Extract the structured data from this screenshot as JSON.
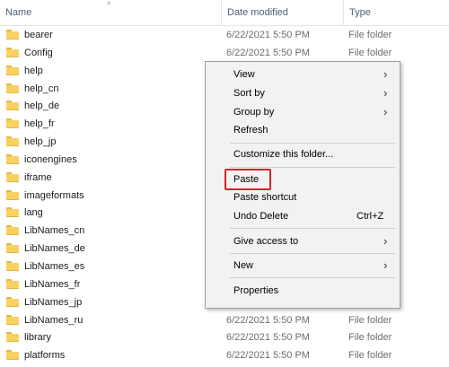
{
  "columns": {
    "name": "Name",
    "date": "Date modified",
    "type": "Type"
  },
  "sort_indicator": "^",
  "files": [
    {
      "name": "bearer",
      "date": "6/22/2021 5:50 PM",
      "type": "File folder"
    },
    {
      "name": "Config",
      "date": "6/22/2021 5:50 PM",
      "type": "File folder"
    },
    {
      "name": "help",
      "date": "",
      "type": ""
    },
    {
      "name": "help_cn",
      "date": "",
      "type": ""
    },
    {
      "name": "help_de",
      "date": "",
      "type": ""
    },
    {
      "name": "help_fr",
      "date": "",
      "type": ""
    },
    {
      "name": "help_jp",
      "date": "",
      "type": ""
    },
    {
      "name": "iconengines",
      "date": "",
      "type": ""
    },
    {
      "name": "iframe",
      "date": "",
      "type": ""
    },
    {
      "name": "imageformats",
      "date": "",
      "type": ""
    },
    {
      "name": "lang",
      "date": "",
      "type": ""
    },
    {
      "name": "LibNames_cn",
      "date": "",
      "type": ""
    },
    {
      "name": "LibNames_de",
      "date": "",
      "type": ""
    },
    {
      "name": "LibNames_es",
      "date": "",
      "type": ""
    },
    {
      "name": "LibNames_fr",
      "date": "",
      "type": ""
    },
    {
      "name": "LibNames_jp",
      "date": "",
      "type": ""
    },
    {
      "name": "LibNames_ru",
      "date": "6/22/2021 5:50 PM",
      "type": "File folder"
    },
    {
      "name": "library",
      "date": "6/22/2021 5:50 PM",
      "type": "File folder"
    },
    {
      "name": "platforms",
      "date": "6/22/2021 5:50 PM",
      "type": "File folder"
    }
  ],
  "context_menu": {
    "view": "View",
    "sort_by": "Sort by",
    "group_by": "Group by",
    "refresh": "Refresh",
    "customize": "Customize this folder...",
    "paste": "Paste",
    "paste_shortcut": "Paste shortcut",
    "undo_delete": "Undo Delete",
    "undo_delete_shortcut": "Ctrl+Z",
    "give_access": "Give access to",
    "new": "New",
    "properties": "Properties",
    "submenu_arrow": "›"
  },
  "colors": {
    "highlight": "#d2232a",
    "folder": "#f8d160",
    "menu_bg": "#f2f2f2"
  }
}
